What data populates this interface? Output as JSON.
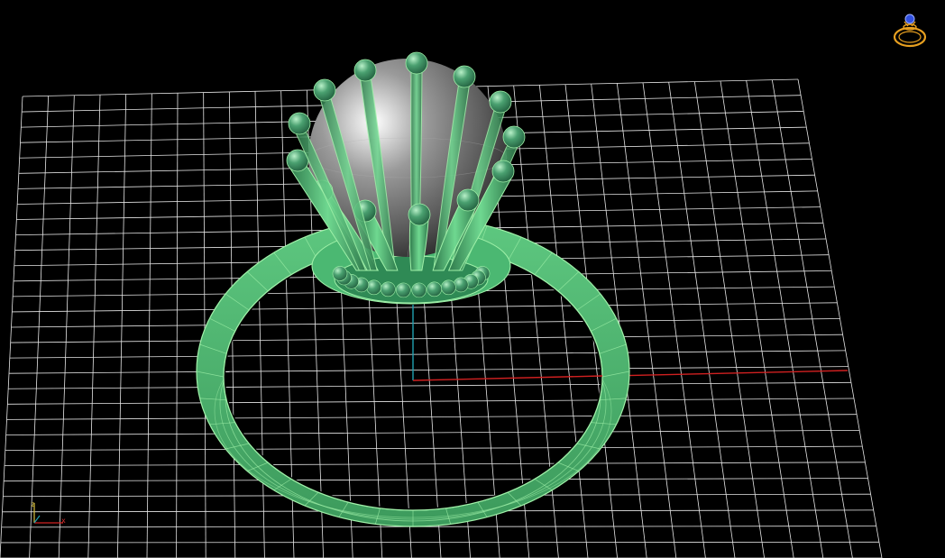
{
  "viewport": {
    "background": "#000000",
    "grid_color": "#ffffff",
    "model_color": "#5fd080",
    "model_edge_color": "#9ff0a8",
    "pearl_color": "#8c8c8c",
    "axis_colors": {
      "x": "#d02020",
      "y": "#20a0b0",
      "z": "#d8c040"
    }
  },
  "view_cube": {
    "icon": "ring-view-cube-icon",
    "color": "#e8a020"
  },
  "axis_triad": {
    "icon": "axis-triad-icon",
    "x_label": "x",
    "z_label": "z"
  }
}
